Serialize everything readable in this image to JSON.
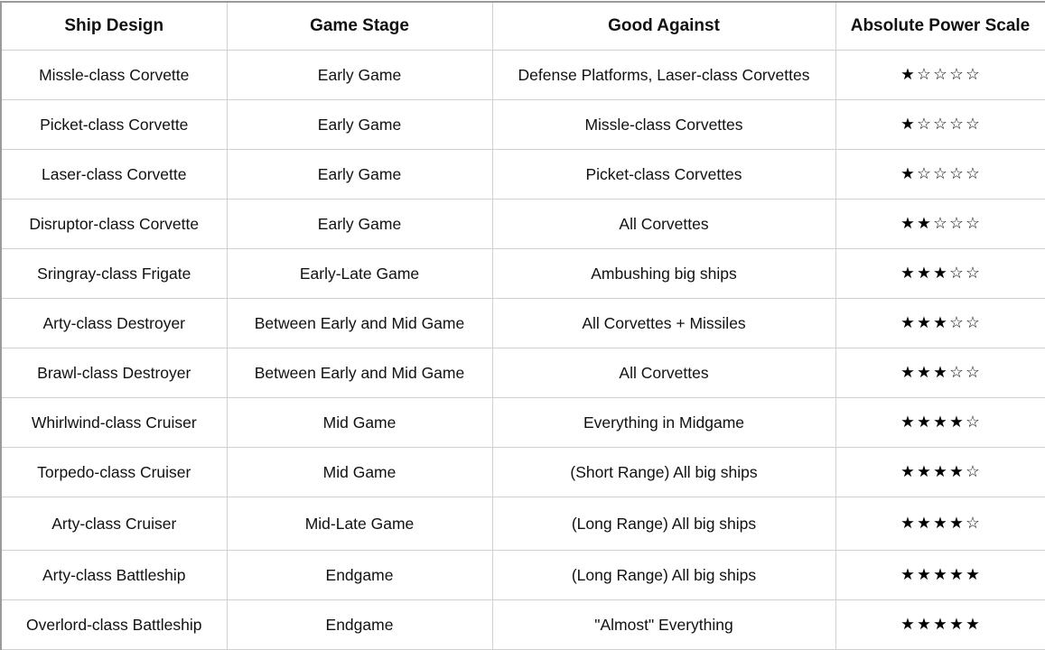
{
  "table": {
    "headers": [
      "Ship Design",
      "Game Stage",
      "Good Against",
      "Absolute Power Scale"
    ],
    "rating_max": 5,
    "rows": [
      {
        "ship": "Missle-class Corvette",
        "stage": "Early Game",
        "good_against": "Defense Platforms, Laser-class Corvettes",
        "rating": 1,
        "stars": "★☆☆☆☆"
      },
      {
        "ship": "Picket-class Corvette",
        "stage": "Early Game",
        "good_against": "Missle-class Corvettes",
        "rating": 1,
        "stars": "★☆☆☆☆"
      },
      {
        "ship": "Laser-class Corvette",
        "stage": "Early Game",
        "good_against": "Picket-class Corvettes",
        "rating": 1,
        "stars": "★☆☆☆☆"
      },
      {
        "ship": "Disruptor-class Corvette",
        "stage": "Early Game",
        "good_against": "All Corvettes",
        "rating": 2,
        "stars": "★★☆☆☆"
      },
      {
        "ship": "Sringray-class Frigate",
        "stage": "Early-Late Game",
        "good_against": "Ambushing big ships",
        "rating": 3,
        "stars": "★★★☆☆"
      },
      {
        "ship": "Arty-class Destroyer",
        "stage": "Between Early and Mid Game",
        "good_against": "All Corvettes + Missiles",
        "rating": 3,
        "stars": "★★★☆☆"
      },
      {
        "ship": "Brawl-class Destroyer",
        "stage": "Between Early and Mid Game",
        "good_against": "All Corvettes",
        "rating": 3,
        "stars": "★★★☆☆"
      },
      {
        "ship": "Whirlwind-class Cruiser",
        "stage": "Mid Game",
        "good_against": "Everything in Midgame",
        "rating": 4,
        "stars": "★★★★☆"
      },
      {
        "ship": "Torpedo-class Cruiser",
        "stage": "Mid Game",
        "good_against": "(Short Range) All big ships",
        "rating": 4,
        "stars": "★★★★☆"
      },
      {
        "ship": "Arty-class Cruiser",
        "stage": "Mid-Late Game",
        "good_against": "(Long Range) All big ships",
        "rating": 4,
        "stars": "★★★★☆"
      },
      {
        "ship": "Arty-class Battleship",
        "stage": "Endgame",
        "good_against": "(Long Range) All big ships",
        "rating": 5,
        "stars": "★★★★★"
      },
      {
        "ship": "Overlord-class Battleship",
        "stage": "Endgame",
        "good_against": "\"Almost\" Everything",
        "rating": 5,
        "stars": "★★★★★"
      }
    ]
  }
}
